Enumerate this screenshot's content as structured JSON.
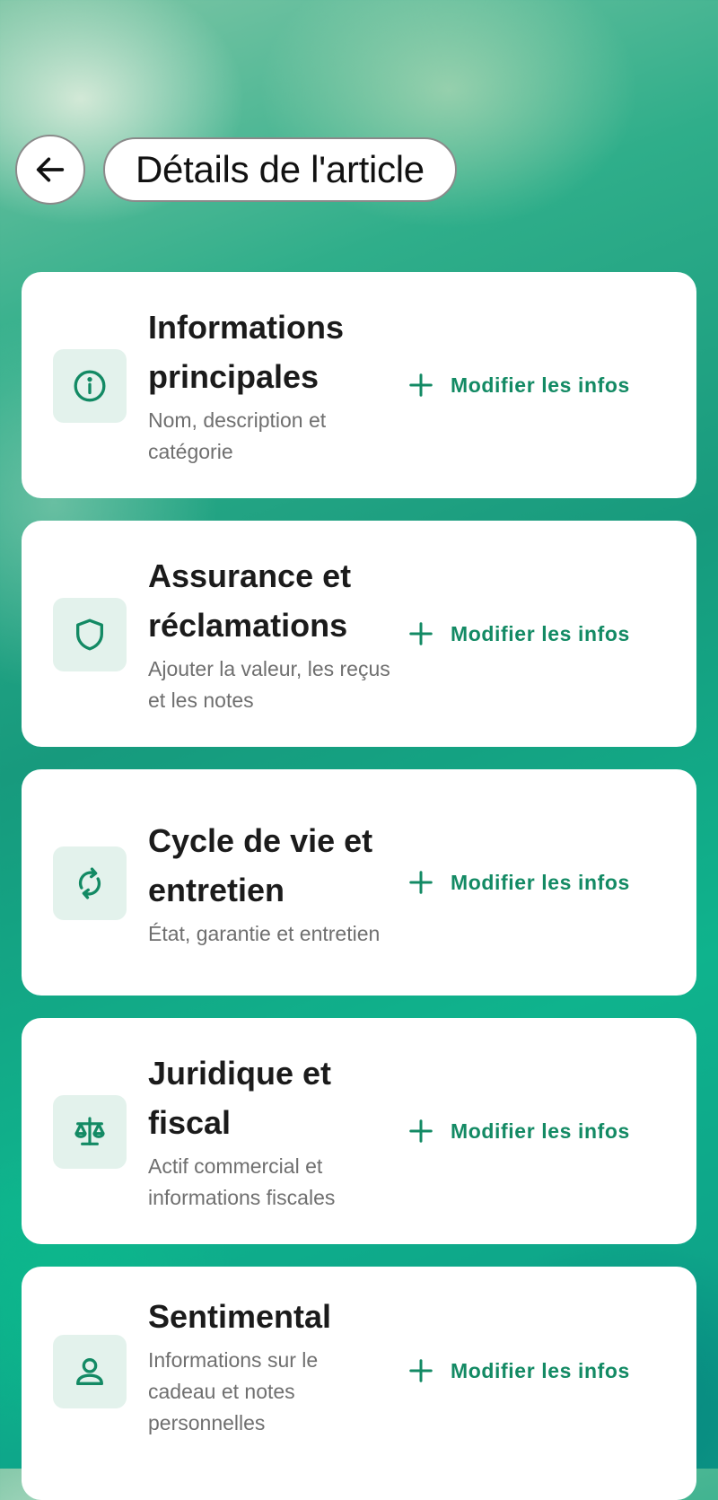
{
  "header": {
    "back_icon": "arrow-left-icon",
    "title": "Détails de l'article"
  },
  "colors": {
    "accent": "#138a64",
    "icon_bg": "#e3f2ec",
    "card_bg": "#ffffff",
    "title_text": "#1b1b1b",
    "subtitle_text": "#6f6f6f"
  },
  "sections": [
    {
      "title": "Informations principales",
      "subtitle": "Nom, description et catégorie",
      "icon": "info-icon",
      "action_label": "Modifier les infos"
    },
    {
      "title": "Assurance et réclamations",
      "subtitle": "Ajouter la valeur, les reçus et les notes",
      "icon": "shield-icon",
      "action_label": "Modifier les infos"
    },
    {
      "title": "Cycle de vie et entretien",
      "subtitle": "État, garantie et entretien",
      "icon": "refresh-icon",
      "action_label": "Modifier les infos"
    },
    {
      "title": "Juridique et fiscal",
      "subtitle": "Actif commercial et informations fiscales",
      "icon": "scale-icon",
      "action_label": "Modifier les infos"
    },
    {
      "title": "Sentimental",
      "subtitle": "Informations sur le cadeau et notes personnelles",
      "icon": "person-icon",
      "action_label": "Modifier les infos"
    }
  ]
}
